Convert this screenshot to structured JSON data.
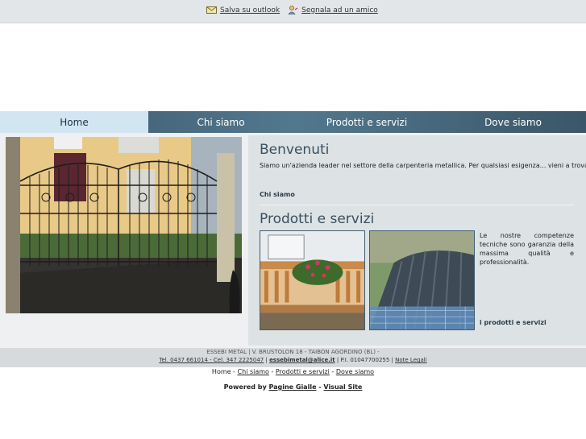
{
  "topbar": {
    "save_label": "Salva su outlook",
    "save_icon": "outlook-icon",
    "recommend_label": "Segnala ad un amico",
    "recommend_icon": "person-icon"
  },
  "nav": {
    "items": [
      {
        "label": "Home",
        "active": true
      },
      {
        "label": "Chi siamo"
      },
      {
        "label": "Prodotti e servizi"
      },
      {
        "label": "Dove siamo"
      }
    ]
  },
  "welcome": {
    "title": "Benvenuti",
    "text": "Siamo un'azienda leader nel settore della carpenteria metallica. Per qualsiasi esigenza... vieni a trovarci!",
    "link": "Chi siamo"
  },
  "products": {
    "title": "Prodotti e servizi",
    "text": "Le nostre competenze tecniche sono garanzia della massima qualità e professionalità.",
    "link": "i prodotti e servizi"
  },
  "footer": {
    "company_line": "ESSEBI METAL | V. BRUSTOLON 18 - TAIBON AGORDINO (BL) -",
    "phone": "Tel. 0437 661014 - Cel. 347 2225047",
    "sep1": " | ",
    "email": "essebimetal@alice.it",
    "sep2": " | P.I. 01047700255 | ",
    "legal": "Note Legali"
  },
  "bottom_nav": {
    "home": "Home",
    "sep": " - ",
    "chi": "Chi siamo",
    "prod": "Prodotti e servizi",
    "dove": "Dove siamo"
  },
  "powered": {
    "label": "Powered by ",
    "pagine": "Pagine Gialle",
    "sep": " - ",
    "visual": "Visual Site"
  },
  "colors": {
    "nav_dark": "#3b5668",
    "nav_active": "#d2e6f2",
    "heading": "#3a4f60"
  }
}
